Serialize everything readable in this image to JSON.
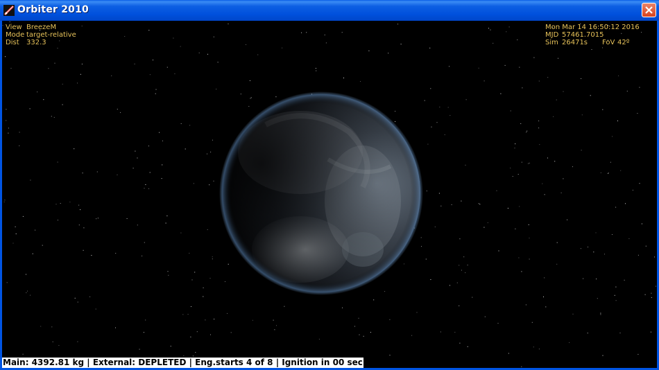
{
  "window": {
    "title": "Orbiter 2010"
  },
  "hud_left": [
    {
      "key": "View",
      "value": "BreezeM"
    },
    {
      "key": "Mode",
      "value": "target-relative"
    },
    {
      "key": "Dist",
      "value": "332.3"
    }
  ],
  "hud_right": {
    "datetime": "Mon Mar 14 16:50:12 2016",
    "mjd_key": "MJD",
    "mjd_value": "57461.7015",
    "sim_key": "Sim",
    "sim_value": "26471s",
    "fov_key": "FoV",
    "fov_value": "42º"
  },
  "status": "Main: 4392.81 kg | External: DEPLETED | Eng.starts 4 of 8 | Ignition in 00 sec",
  "colors": {
    "hud": "#e8c35a",
    "title_bar": "#0054e3",
    "space": "#000000"
  }
}
